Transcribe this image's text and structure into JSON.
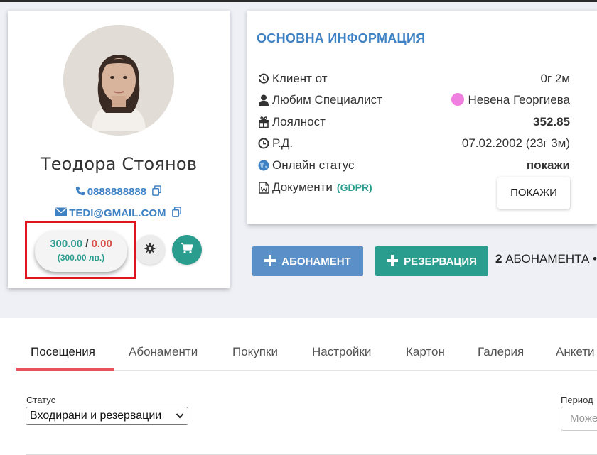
{
  "client": {
    "name": "Теодора Стоянов",
    "phone": "0888888888",
    "email": "TEDI@GMAIL.COM",
    "balance_positive": "300.00",
    "balance_separator": "/",
    "balance_negative": "0.00",
    "balance_total": "(300.00 лв.)"
  },
  "info": {
    "title": "ОСНОВНА ИНФОРМАЦИЯ",
    "rows": [
      {
        "label": "Клиент от",
        "value": "0г 2м",
        "icon": "history-icon"
      },
      {
        "label": "Любим Специалист",
        "value": "Невена Георгиева",
        "icon": "user-icon"
      },
      {
        "label": "Лоялност",
        "value": "352.85",
        "icon": "gift-icon"
      },
      {
        "label": "Р.Д.",
        "value": "07.02.2002 (23г 3м)",
        "icon": "clock-icon"
      },
      {
        "label": "Онлайн статус",
        "value": "покажи",
        "icon": "globe-icon"
      },
      {
        "label": "Документи",
        "value": "(GDPR)",
        "icon": "document-icon"
      }
    ],
    "show_button": "ПОКАЖИ",
    "specialist_color": "#f080e0"
  },
  "actions": {
    "subscription_button": "АБОНАМЕНТ",
    "reservation_button": "РЕЗЕРВАЦИЯ",
    "subscription_count_number": "2",
    "subscription_count_text": "АБОНАМЕНТА •"
  },
  "tabs": [
    "Посещения",
    "Абонаменти",
    "Покупки",
    "Настройки",
    "Картон",
    "Галерия",
    "Анкети"
  ],
  "filters": {
    "status_label": "Статус",
    "status_value": "Входирани и резервации",
    "period_label": "Период",
    "period_placeholder": "Можете"
  },
  "colors": {
    "accent_blue": "#3f82c4",
    "teal": "#2a9d8f",
    "danger": "#d9534f",
    "tab_active": "#e8525a",
    "highlight": "#e0141e"
  }
}
